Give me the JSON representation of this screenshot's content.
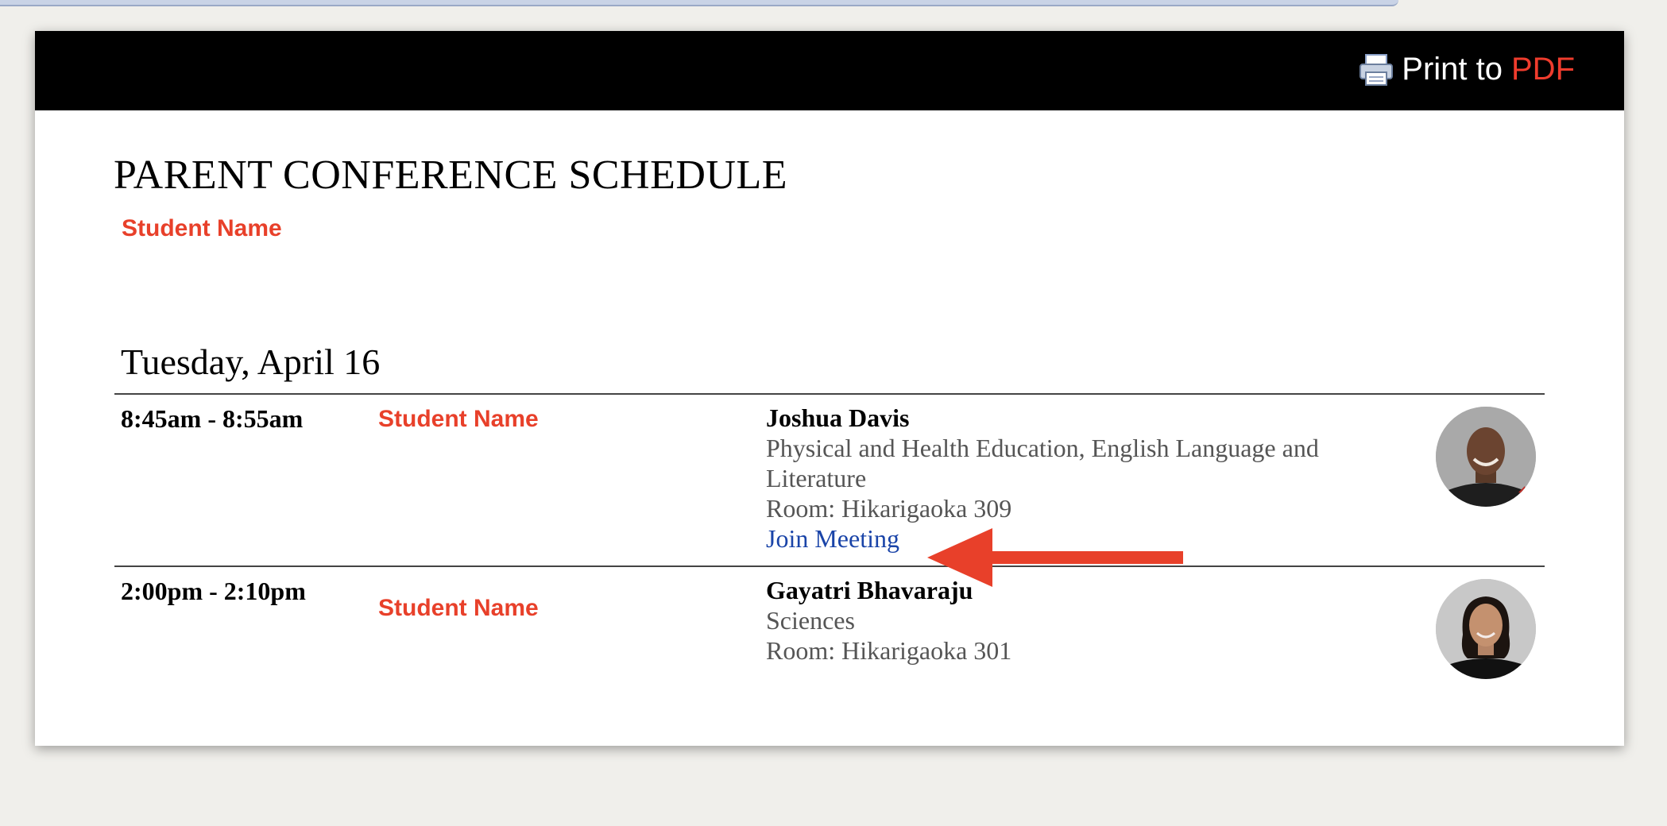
{
  "header": {
    "print_label": "Print to",
    "print_accent": "PDF"
  },
  "page": {
    "title": "PARENT CONFERENCE SCHEDULE",
    "student_name": "Student Name"
  },
  "day": {
    "heading": "Tuesday, April 16",
    "slots": [
      {
        "time": "8:45am - 8:55am",
        "student": "Student Name",
        "teacher": "Joshua Davis",
        "subjects": "Physical and Health Education, English Language and Literature",
        "room": "Room: Hikarigaoka 309",
        "join_label": "Join Meeting"
      },
      {
        "time": "2:00pm - 2:10pm",
        "student": "Student Name",
        "teacher": "Gayatri Bhavaraju",
        "subjects": "Sciences",
        "room": "Room: Hikarigaoka 301"
      }
    ]
  },
  "colors": {
    "accent": "#e8402a",
    "link": "#1a44a8",
    "header_bg": "#000000"
  },
  "icons": {
    "print": "printer-icon",
    "annotation": "arrow-left-annotation"
  }
}
